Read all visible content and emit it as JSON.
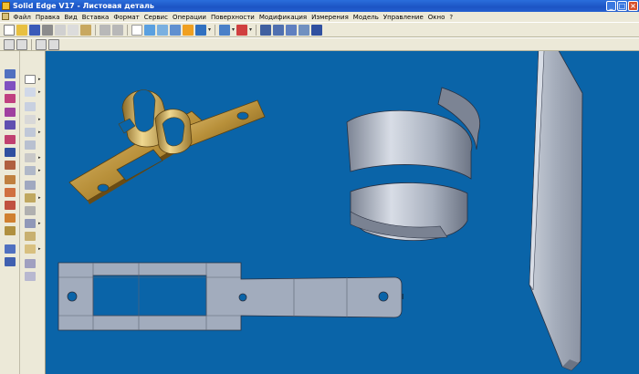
{
  "window": {
    "title": "Solid Edge V17 - Листовая деталь",
    "buttons": [
      "_",
      "□",
      "×"
    ]
  },
  "menu": {
    "items": [
      "Файл",
      "Правка",
      "Вид",
      "Вставка",
      "Формат",
      "Сервис",
      "Операции",
      "Поверхности",
      "Модификация",
      "Измерения",
      "Модель",
      "Управление",
      "Окно",
      "?"
    ]
  },
  "toolbar": {
    "icons": [
      "new-icon",
      "open-icon",
      "save-icon",
      "print-icon",
      "cut-icon",
      "copy-icon",
      "paste-icon",
      "undo-icon",
      "redo-icon",
      "select-icon",
      "zoom-icon",
      "fit-icon",
      "pan-icon",
      "rotate-icon",
      "shading-icon",
      "help-icon"
    ]
  },
  "left_toolbar": {
    "icons": [
      "sheet-metal-icon",
      "flange-icon",
      "contour-flange-icon",
      "tab-icon",
      "cutout-icon",
      "bend-icon",
      "dimple-icon",
      "louver-icon",
      "emboss-icon",
      "hole-icon",
      "rib-icon",
      "gusset-icon",
      "mirror-icon",
      "pattern-icon",
      "unbend-icon",
      "close-corner-icon",
      "break-corner-icon",
      "flat-pattern-icon"
    ]
  },
  "viewport": {
    "background_color": "#0a64a8",
    "objects": [
      "bracket-part",
      "spiral-strip-part",
      "flat-pattern",
      "bent-plate"
    ],
    "part_colors": {
      "bronze": "#b8903a",
      "steel": "#a9b2c2",
      "flat": "#a2acbd"
    }
  }
}
